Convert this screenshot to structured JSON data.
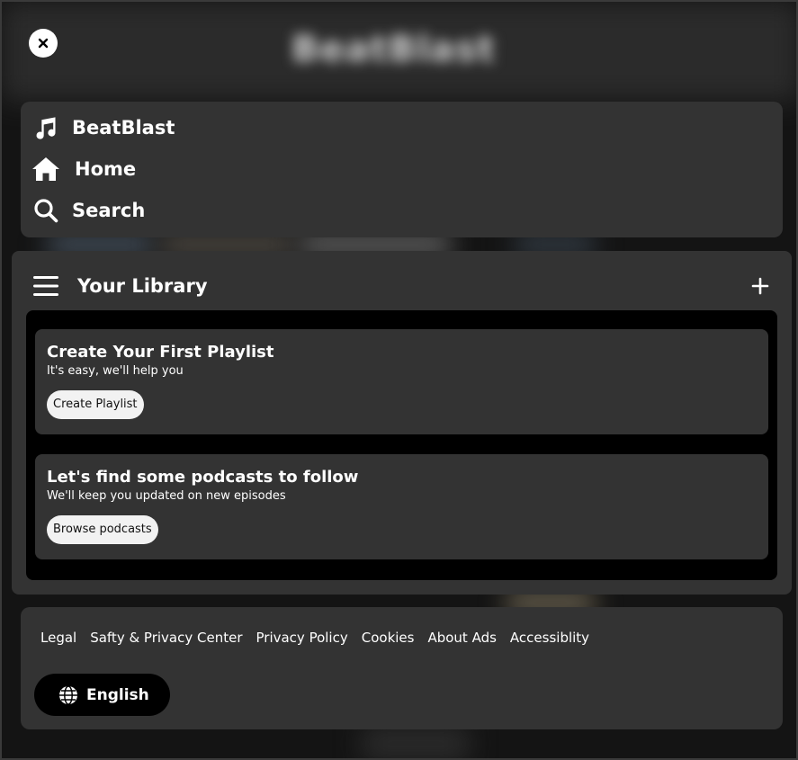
{
  "background": {
    "blurred_title": "BeatBlast"
  },
  "close": {
    "icon": "close-icon"
  },
  "nav": {
    "items": [
      {
        "label": "BeatBlast",
        "icon": "music-note-icon"
      },
      {
        "label": "Home",
        "icon": "home-icon"
      },
      {
        "label": "Search",
        "icon": "search-icon"
      }
    ]
  },
  "library": {
    "title": "Your Library",
    "icon": "library-menu-icon",
    "add_icon": "plus-icon",
    "cards": [
      {
        "title": "Create Your First Playlist",
        "subtitle": "It's easy, we'll help you",
        "button": "Create Playlist"
      },
      {
        "title": "Let's find some podcasts to follow",
        "subtitle": "We'll keep you updated on new episodes",
        "button": "Browse podcasts"
      }
    ]
  },
  "footer": {
    "links": [
      "Legal",
      "Safty & Privacy Center",
      "Privacy Policy",
      "Cookies",
      "About Ads",
      "Accessiblity"
    ],
    "language": {
      "label": "English",
      "icon": "globe-icon"
    }
  },
  "colors": {
    "panel": "#333333",
    "inner": "#000000",
    "button_light": "#f2f2f2",
    "text": "#ffffff"
  }
}
